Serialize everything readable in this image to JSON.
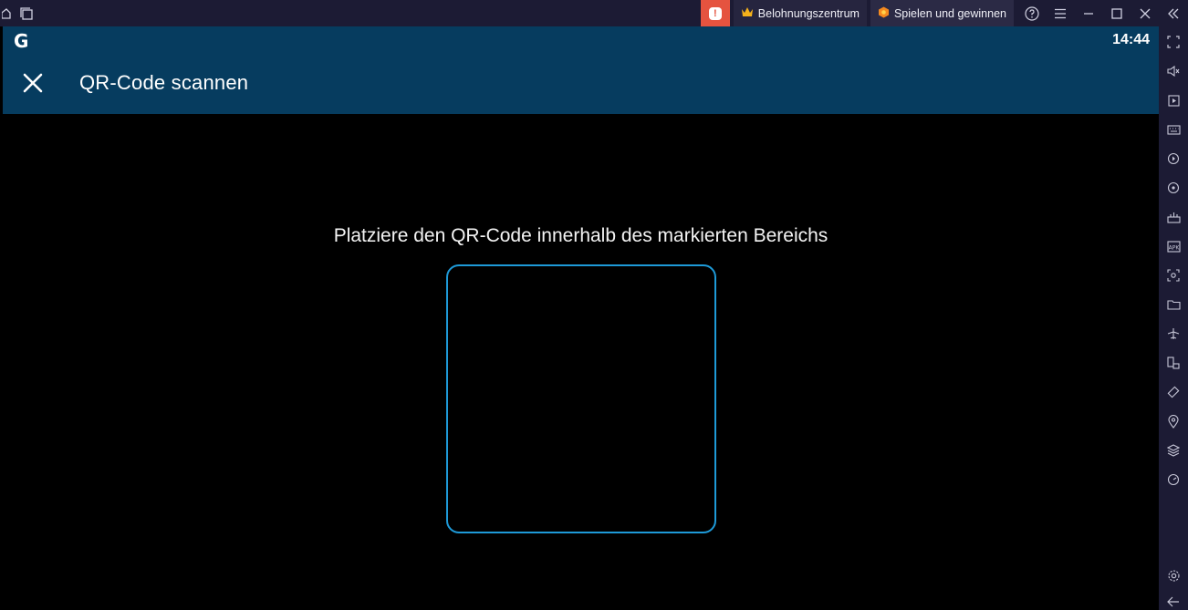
{
  "titlebar": {
    "alert_glyph": "!",
    "rewards_label": "Belohnungszentrum",
    "play_label": "Spielen und gewinnen",
    "accent_alert": "#e5533f"
  },
  "status": {
    "logo": "G",
    "time": "14:44"
  },
  "appbar": {
    "title": "QR-Code scannen",
    "background": "#063c5f"
  },
  "scanner": {
    "hint": "Platziere den QR-Code innerhalb des markierten Bereichs",
    "frame_color": "#1e9ad8"
  },
  "sidebar_icons": [
    "fullscreen-icon",
    "volume-icon",
    "media-icon",
    "keyboard-icon",
    "macro-icon",
    "sync-icon",
    "build-icon",
    "apk-icon",
    "screenshot-icon",
    "folder-icon",
    "airplane-icon",
    "rotate-devices-icon",
    "shake-icon",
    "location-icon",
    "layers-icon",
    "speed-icon",
    "settings-icon",
    "back-icon"
  ]
}
